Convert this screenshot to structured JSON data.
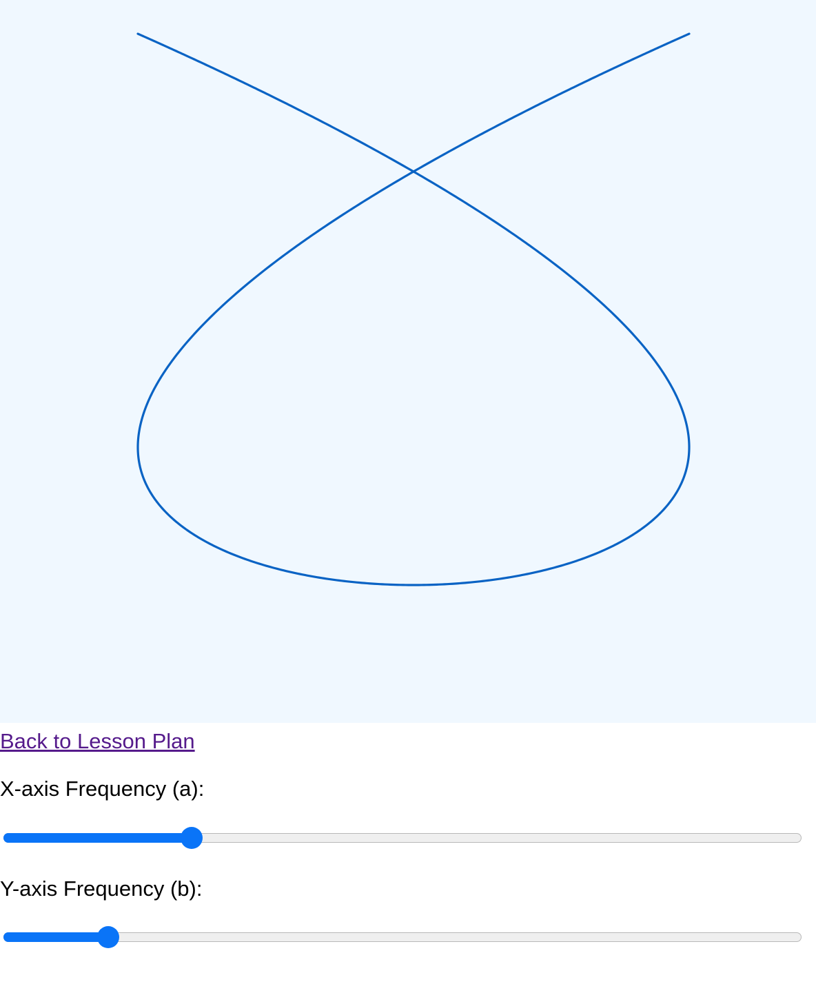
{
  "links": {
    "back": "Back to Lesson Plan"
  },
  "controls": {
    "x_label": "X-axis Frequency (a):",
    "y_label": "Y-axis Frequency (b):",
    "x_slider": {
      "value": 3,
      "min": 1,
      "max": 10,
      "fraction": 0.2282
    },
    "y_slider": {
      "value": 2,
      "min": 1,
      "max": 10,
      "fraction": 0.1204
    }
  },
  "curve": {
    "type": "lissajous",
    "a": 3,
    "b": 2,
    "phase": 0.7853981633974483,
    "color": "#0a63c4"
  },
  "colors": {
    "canvas_bg": "#f0f8ff",
    "accent": "#0a74f7",
    "link": "#551a8b"
  }
}
